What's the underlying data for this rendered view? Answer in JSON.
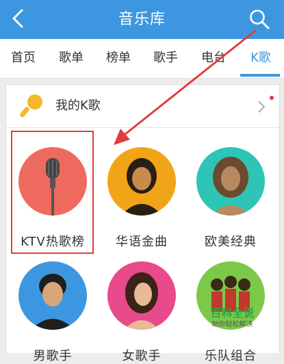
{
  "header": {
    "title": "音乐库",
    "back_icon": "back-arrow-icon",
    "search_icon": "search-icon",
    "background_color": "#3d97e0"
  },
  "tabs": [
    {
      "label": "首页"
    },
    {
      "label": "歌单"
    },
    {
      "label": "榜单"
    },
    {
      "label": "歌手"
    },
    {
      "label": "电台"
    },
    {
      "label": "K歌",
      "active": true
    }
  ],
  "my_k": {
    "label": "我的K歌",
    "icon": "microphone-icon",
    "has_notification_dot": true
  },
  "categories": [
    {
      "label": "KTV热歌榜",
      "color": "#ef6a5e",
      "highlighted": true
    },
    {
      "label": "华语金曲",
      "color": "#f2a418"
    },
    {
      "label": "欧美经典",
      "color": "#2ec4b6"
    },
    {
      "label": "男歌手",
      "color": "#3d97e0"
    },
    {
      "label": "女歌手",
      "color": "#e94a8b"
    },
    {
      "label": "乐队组合",
      "color": "#7cc94a"
    }
  ],
  "annotation": {
    "arrow_color": "#e23c3c"
  },
  "watermark": {
    "title": "百科全说",
    "subtitle": "助你轻松解决"
  }
}
